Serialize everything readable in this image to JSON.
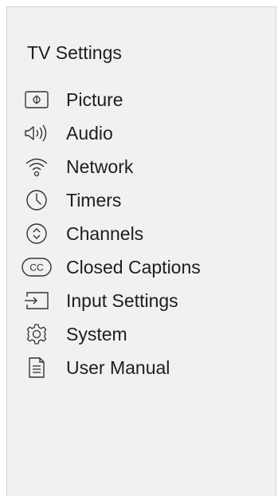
{
  "header": {
    "title": "TV Settings"
  },
  "menu": {
    "items": [
      {
        "label": "Picture",
        "icon": "picture-icon"
      },
      {
        "label": "Audio",
        "icon": "audio-icon"
      },
      {
        "label": "Network",
        "icon": "wifi-icon"
      },
      {
        "label": "Timers",
        "icon": "clock-icon"
      },
      {
        "label": "Channels",
        "icon": "channels-icon"
      },
      {
        "label": "Closed Captions",
        "icon": "cc-icon"
      },
      {
        "label": "Input Settings",
        "icon": "input-icon"
      },
      {
        "label": "System",
        "icon": "gear-icon"
      },
      {
        "label": "User Manual",
        "icon": "document-icon"
      }
    ]
  },
  "colors": {
    "panel_background": "#f1f1f1",
    "text": "#1e1e1e",
    "icon_stroke": "#333333"
  }
}
